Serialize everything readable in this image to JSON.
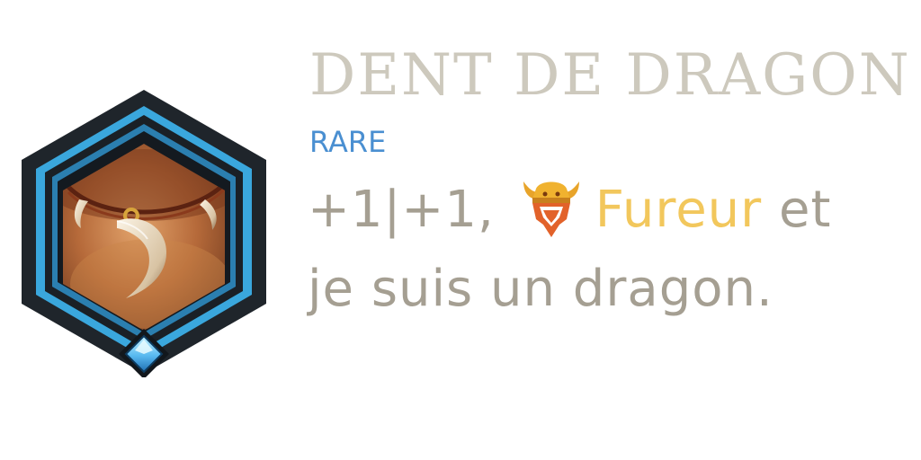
{
  "card": {
    "name": "DENT DE DRAGON",
    "rarity": "RARE",
    "description": {
      "stats": "+1|+1,",
      "keyword_icon": "fury-icon",
      "keyword": "Fureur",
      "connector": " et",
      "line2": "je suis un dragon."
    },
    "art_icon": "dragon-tooth-necklace-icon",
    "gem_icon": "rarity-gem-icon"
  },
  "colors": {
    "title": "#cdc9bd",
    "rarity": "#4a8fd1",
    "text": "#a59f92",
    "keyword": "#f2c75c",
    "frame_dark": "#1c2228",
    "frame_blue": "#3aa7dd",
    "gem": "#6fd3ff"
  }
}
